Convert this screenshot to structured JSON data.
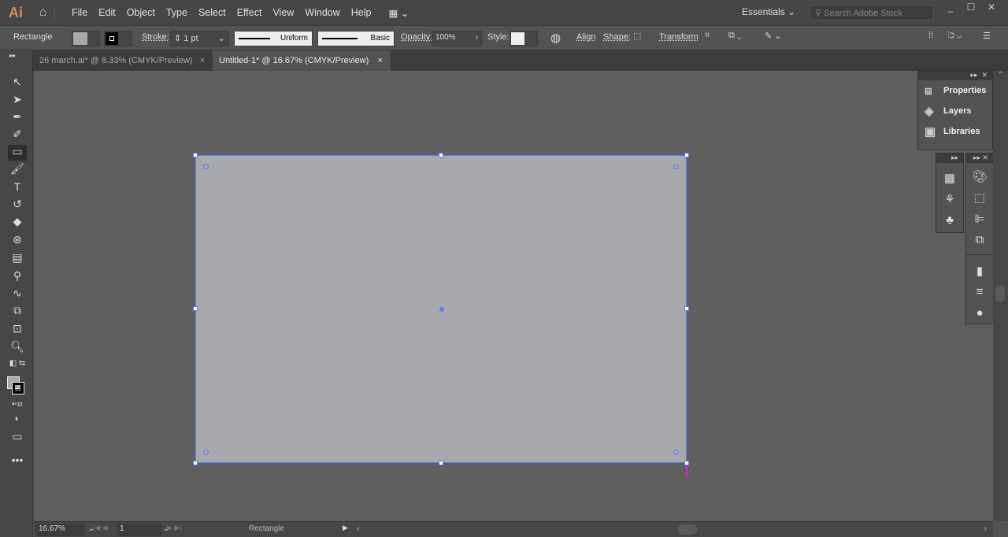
{
  "app": {
    "logo": "Ai",
    "home_icon": "home-icon"
  },
  "menu": [
    "File",
    "Edit",
    "Object",
    "Type",
    "Select",
    "Effect",
    "View",
    "Window",
    "Help"
  ],
  "workspace": "Essentials",
  "search_placeholder": "Search Adobe Stock",
  "control": {
    "object_type": "Rectangle",
    "stroke_label": "Stroke:",
    "stroke_weight": "1 pt",
    "profile": "Uniform",
    "brush": "Basic",
    "opacity_label": "Opacity:",
    "opacity": "100%",
    "style_label": "Style:",
    "align": "Align",
    "shape": "Shape:",
    "transform": "Transform",
    "fill_color": "#a8a9ad"
  },
  "tabs": [
    {
      "label": "26 march.ai* @ 8.33% (CMYK/Preview)",
      "active": false
    },
    {
      "label": "Untitled-1* @ 16.67% (CMYK/Preview)",
      "active": true
    }
  ],
  "panels": {
    "items": [
      "Properties",
      "Layers",
      "Libraries"
    ]
  },
  "status": {
    "zoom": "16.67%",
    "artboard": "1",
    "tool": "Rectangle"
  },
  "colors": {
    "selection": "#4f7ff7",
    "artboard_fill": "#a8a9ad",
    "logo": "#d98e4f"
  }
}
